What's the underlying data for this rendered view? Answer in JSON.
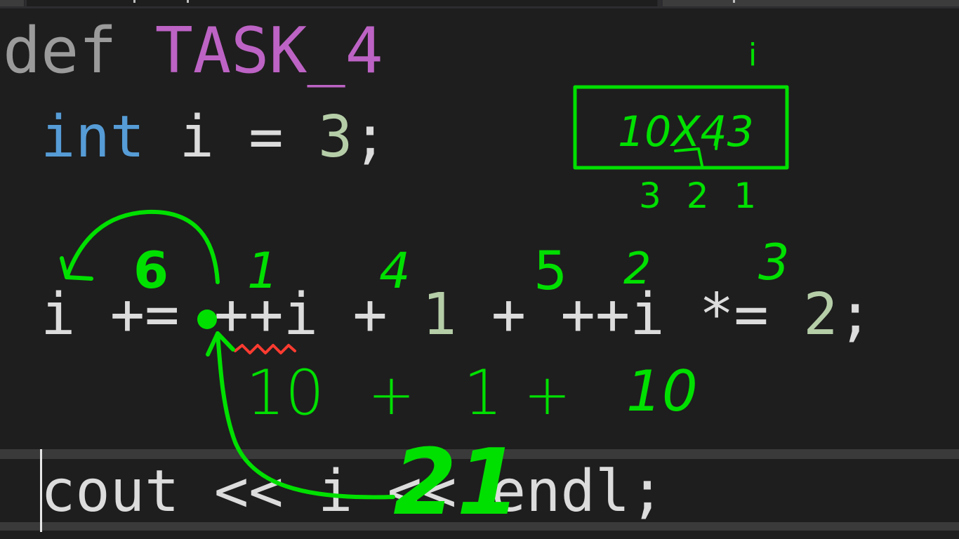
{
  "editor": {
    "lines": [
      {
        "kw": "def",
        "name": "TASK_4"
      },
      {
        "type": "int",
        "rest": " i = ",
        "value": "3",
        "end": ";"
      },
      {
        "lhs": "i += ",
        "expr1": "++i + ",
        "one": "1",
        "expr2": " + ++i *= ",
        "two": "2",
        "end": ";"
      },
      {
        "text": "cout << i << endl;"
      }
    ]
  },
  "annotations": {
    "color": "#00e000",
    "squiggle_color": "#ff3b30",
    "label_i": "i",
    "box_text": "10X43",
    "below_box": "3 2 1",
    "order_numbers": [
      "6",
      "1",
      "4",
      "5",
      "2",
      "3"
    ],
    "operands": [
      "10",
      "+",
      "1",
      "+",
      "10"
    ],
    "result": "21"
  }
}
